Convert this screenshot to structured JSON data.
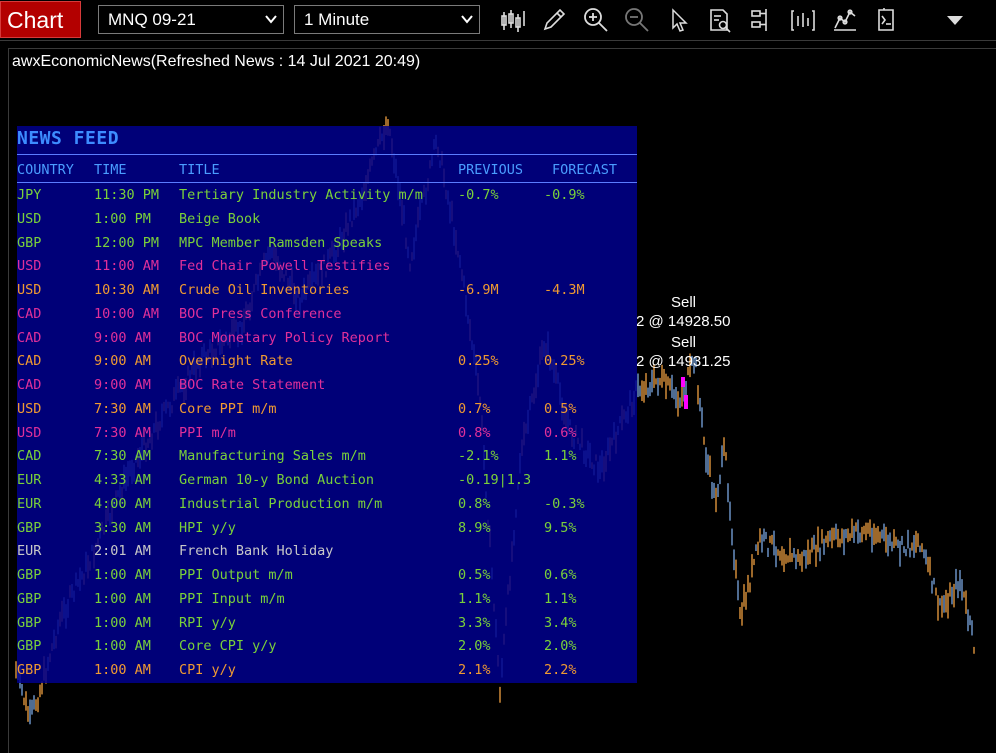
{
  "toolbar": {
    "chart_label": "Chart",
    "symbol": "MNQ 09-21",
    "interval": "1 Minute",
    "tools": [
      "bar-type-icon",
      "pencil-icon",
      "zoom-in-icon",
      "zoom-out-icon",
      "pointer-icon",
      "data-box-icon",
      "indicators-icon",
      "strategy-icon",
      "chart-trader-icon",
      "properties-icon",
      "menu-dropdown-icon"
    ]
  },
  "indicator_label": "awxEconomicNews(Refreshed News : 14 Jul 2021 20:49)",
  "trades": {
    "sell1_label": "Sell",
    "sell1_price": "2 @ 14928.50",
    "sell2_label": "Sell",
    "sell2_price": "2 @ 14931.25"
  },
  "news": {
    "title": "NEWS FEED",
    "headers": {
      "country": "COUNTRY",
      "time": "TIME",
      "title": "TITLE",
      "previous": "PREVIOUS",
      "forecast": "FORECAST"
    },
    "rows": [
      {
        "country": "JPY",
        "time": "11:30 PM",
        "title": "Tertiary Industry Activity m/m",
        "previous": "-0.7%",
        "forecast": "-0.9%",
        "color": "#7ad13a"
      },
      {
        "country": "USD",
        "time": "1:00 PM",
        "title": "Beige Book",
        "previous": "",
        "forecast": "",
        "color": "#7ad13a"
      },
      {
        "country": "GBP",
        "time": "12:00 PM",
        "title": "MPC Member Ramsden Speaks",
        "previous": "",
        "forecast": "",
        "color": "#7ad13a"
      },
      {
        "country": "USD",
        "time": "11:00 AM",
        "title": "Fed Chair Powell Testifies",
        "previous": "",
        "forecast": "",
        "color": "#e0309a"
      },
      {
        "country": "USD",
        "time": "10:30 AM",
        "title": "Crude Oil Inventories",
        "previous": "-6.9M",
        "forecast": "-4.3M",
        "color": "#f09a32"
      },
      {
        "country": "CAD",
        "time": "10:00 AM",
        "title": "BOC Press Conference",
        "previous": "",
        "forecast": "",
        "color": "#e0309a"
      },
      {
        "country": "CAD",
        "time": "9:00 AM",
        "title": "BOC Monetary Policy Report",
        "previous": "",
        "forecast": "",
        "color": "#e0309a"
      },
      {
        "country": "CAD",
        "time": "9:00 AM",
        "title": "Overnight Rate",
        "previous": "0.25%",
        "forecast": "0.25%",
        "color": "#f09a32"
      },
      {
        "country": "CAD",
        "time": "9:00 AM",
        "title": "BOC Rate Statement",
        "previous": "",
        "forecast": "",
        "color": "#e0309a"
      },
      {
        "country": "USD",
        "time": "7:30 AM",
        "title": "Core PPI m/m",
        "previous": "0.7%",
        "forecast": "0.5%",
        "color": "#f09a32"
      },
      {
        "country": "USD",
        "time": "7:30 AM",
        "title": "PPI m/m",
        "previous": "0.8%",
        "forecast": "0.6%",
        "color": "#e0309a"
      },
      {
        "country": "CAD",
        "time": "7:30 AM",
        "title": "Manufacturing Sales m/m",
        "previous": "-2.1%",
        "forecast": "1.1%",
        "color": "#7ad13a"
      },
      {
        "country": "EUR",
        "time": "4:33 AM",
        "title": "German 10-y Bond Auction",
        "previous": "-0.19|1.3",
        "forecast": "",
        "color": "#7ad13a"
      },
      {
        "country": "EUR",
        "time": "4:00 AM",
        "title": "Industrial Production m/m",
        "previous": "0.8%",
        "forecast": "-0.3%",
        "color": "#7ad13a"
      },
      {
        "country": "GBP",
        "time": "3:30 AM",
        "title": "HPI y/y",
        "previous": "8.9%",
        "forecast": "9.5%",
        "color": "#7ad13a"
      },
      {
        "country": "EUR",
        "time": "2:01 AM",
        "title": "French Bank Holiday",
        "previous": "",
        "forecast": "",
        "color": "#c8c8c8"
      },
      {
        "country": "GBP",
        "time": "1:00 AM",
        "title": "PPI Output m/m",
        "previous": "0.5%",
        "forecast": "0.6%",
        "color": "#7ad13a"
      },
      {
        "country": "GBP",
        "time": "1:00 AM",
        "title": "PPI Input m/m",
        "previous": "1.1%",
        "forecast": "1.1%",
        "color": "#7ad13a"
      },
      {
        "country": "GBP",
        "time": "1:00 AM",
        "title": "RPI y/y",
        "previous": "3.3%",
        "forecast": "3.4%",
        "color": "#7ad13a"
      },
      {
        "country": "GBP",
        "time": "1:00 AM",
        "title": "Core CPI y/y",
        "previous": "2.0%",
        "forecast": "2.0%",
        "color": "#7ad13a"
      },
      {
        "country": "GBP",
        "time": "1:00 AM",
        "title": "CPI y/y",
        "previous": "2.1%",
        "forecast": "2.2%",
        "color": "#f09a32"
      }
    ]
  },
  "colors": {
    "header": "#4a9dff",
    "panel": "#00008c",
    "candle_up": "#7aa7e0",
    "candle_down": "#f0a040",
    "sell_marker": "#ff00ff"
  }
}
